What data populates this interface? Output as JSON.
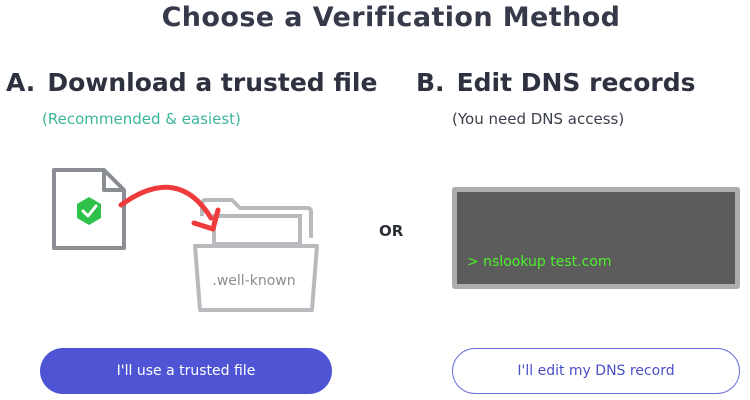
{
  "title": "Choose a Verification Method",
  "option_a": {
    "letter": "A.",
    "heading": "Download a trusted file",
    "subtitle": "(Recommended & easiest)",
    "folder_label": ".well-known",
    "button_label": "I'll use a trusted file"
  },
  "divider_label": "OR",
  "option_b": {
    "letter": "B.",
    "heading": "Edit DNS records",
    "subtitle": "(You need DNS access)",
    "terminal_command": "> nslookup test.com",
    "button_label": "I'll edit my DNS record"
  },
  "colors": {
    "accent": "#4f54d4",
    "recommended": "#3db59a",
    "check_badge": "#2fc24a",
    "arrow": "#ef3b3b",
    "terminal_bg": "#5c5c5c",
    "terminal_text": "#4cf02a"
  },
  "icons": {
    "file": "file-check-icon",
    "folder": "folder-icon",
    "arrow": "curved-arrow-icon",
    "terminal": "terminal-window"
  }
}
